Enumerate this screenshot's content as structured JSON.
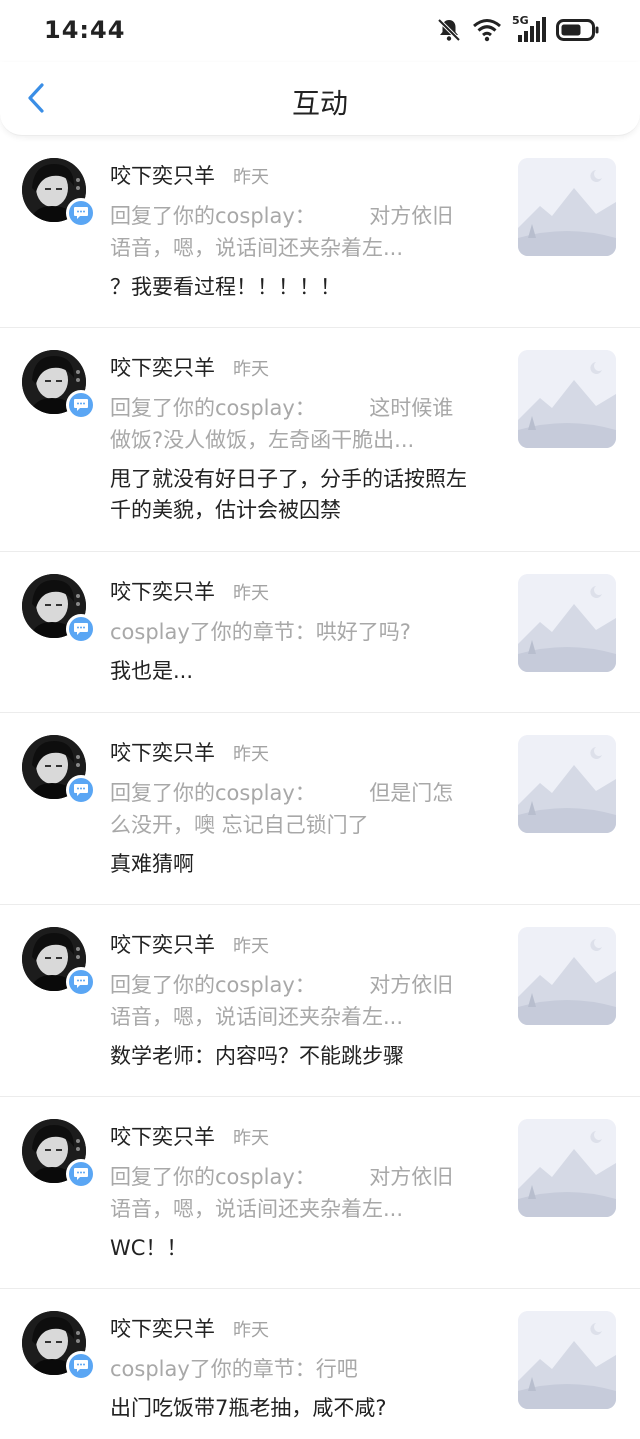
{
  "status_bar": {
    "time": "14:44",
    "network": "5G"
  },
  "header": {
    "title": "互动"
  },
  "items": [
    {
      "username": "咬下奕只羊",
      "time": "昨天",
      "quote": "回复了你的cosplay：        对方依旧语音，嗯，说话间还夹杂着左...",
      "reply": "？我要看过程！！！！！"
    },
    {
      "username": "咬下奕只羊",
      "time": "昨天",
      "quote": "回复了你的cosplay：        这时候谁做饭?没人做饭，左奇函干脆出...",
      "reply": "甩了就没有好日子了，分手的话按照左千的美貌，估计会被囚禁"
    },
    {
      "username": "咬下奕只羊",
      "time": "昨天",
      "quote": "cosplay了你的章节：哄好了吗?",
      "reply": "我也是..."
    },
    {
      "username": "咬下奕只羊",
      "time": "昨天",
      "quote": "回复了你的cosplay：        但是门怎么没开，噢 忘记自己锁门了",
      "reply": "真难猜啊"
    },
    {
      "username": "咬下奕只羊",
      "time": "昨天",
      "quote": "回复了你的cosplay：        对方依旧语音，嗯，说话间还夹杂着左...",
      "reply": "数学老师：内容吗？不能跳步骤"
    },
    {
      "username": "咬下奕只羊",
      "time": "昨天",
      "quote": "回复了你的cosplay：        对方依旧语音，嗯，说话间还夹杂着左...",
      "reply": "WC！！"
    },
    {
      "username": "咬下奕只羊",
      "time": "昨天",
      "quote": "cosplay了你的章节：行吧",
      "reply": "出门吃饭带7瓶老抽，咸不咸?"
    }
  ],
  "colors": {
    "accent": "#3a8ee6",
    "badge": "#5aa6f4",
    "muted_text": "#a8a8a8",
    "primary_text": "#222222",
    "divider": "#ececec"
  }
}
